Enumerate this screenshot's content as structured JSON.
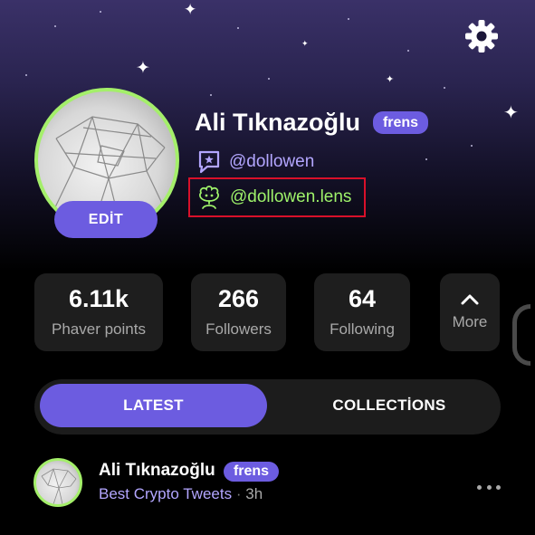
{
  "profile": {
    "name": "Ali Tıknazoğlu",
    "badge": "frens",
    "edit_label": "EDİT",
    "farcaster_handle": "@dollowen",
    "lens_handle": "@dollowen.lens"
  },
  "stats": [
    {
      "value": "6.11k",
      "label": "Phaver points"
    },
    {
      "value": "266",
      "label": "Followers"
    },
    {
      "value": "64",
      "label": "Following"
    }
  ],
  "more_label": "More",
  "tabs": [
    {
      "label": "LATEST",
      "active": true
    },
    {
      "label": "COLLECTİONS",
      "active": false
    }
  ],
  "post": {
    "author": "Ali Tıknazoğlu",
    "badge": "frens",
    "community": "Best Crypto Tweets",
    "separator": "·",
    "time": "3h"
  },
  "icons": {
    "settings": "gear-icon",
    "farcaster": "farcaster-icon",
    "lens": "lens-icon",
    "more": "chevron-up-icon",
    "post_options": "more-horizontal-icon"
  },
  "colors": {
    "accent": "#6c5ce0",
    "lens_green": "#9ef26a",
    "highlight_border": "#d8102a",
    "handle_purple": "#b3a6ff"
  }
}
